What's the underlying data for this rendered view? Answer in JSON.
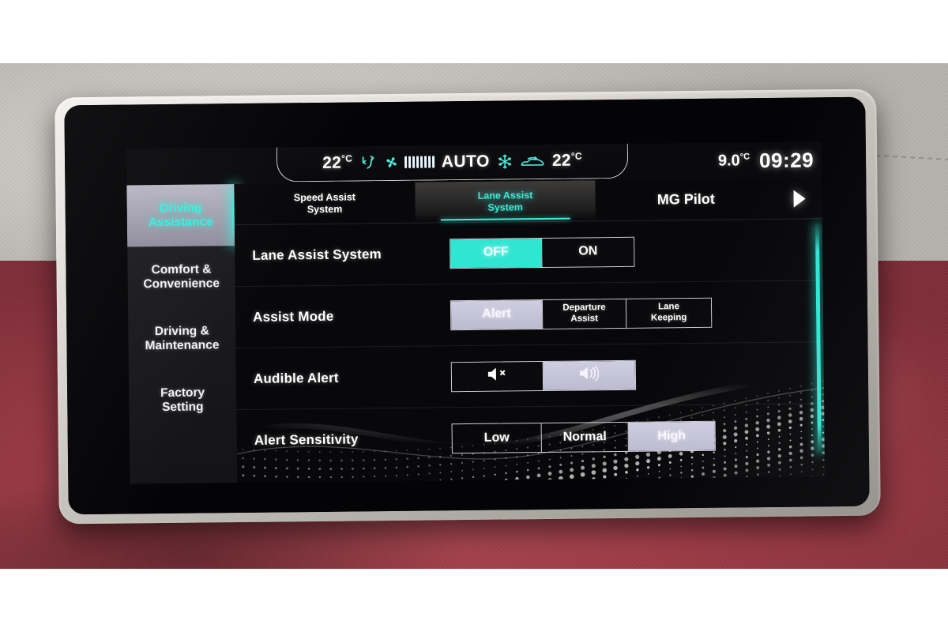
{
  "status_bar": {
    "cabin_temp_left": "22",
    "cabin_temp_left_unit": "°C",
    "airflow_icon": "airflow-direction-icon",
    "fan_icon": "fan-icon",
    "fan_level_bars": 8,
    "auto_label": "AUTO",
    "ac_icon": "snowflake-icon",
    "recirculation_icon": "air-recirculation-car-icon",
    "cabin_temp_right": "22",
    "cabin_temp_right_unit": "°C",
    "outside_temp": "9.0",
    "outside_temp_unit": "°C",
    "clock": "09:29"
  },
  "sidebar": {
    "items": [
      {
        "label_line1": "Driving",
        "label_line2": "Assistance",
        "active": true
      },
      {
        "label_line1": "Comfort &",
        "label_line2": "Convenience",
        "active": false
      },
      {
        "label_line1": "Driving &",
        "label_line2": "Maintenance",
        "active": false
      },
      {
        "label_line1": "Factory",
        "label_line2": "Setting",
        "active": false
      }
    ]
  },
  "tabs": {
    "items": [
      {
        "line1": "Speed Assist",
        "line2": "System",
        "active": false
      },
      {
        "line1": "Lane Assist",
        "line2": "System",
        "active": true
      },
      {
        "line1": "MG Pilot",
        "line2": "",
        "active": false
      }
    ],
    "next_arrow_icon": "next-arrow-icon"
  },
  "settings": {
    "rows": [
      {
        "label": "Lane Assist System",
        "options": [
          {
            "text": "OFF",
            "selected": true,
            "style": "cyan"
          },
          {
            "text": "ON",
            "selected": false,
            "style": "dark"
          }
        ]
      },
      {
        "label": "Assist Mode",
        "options": [
          {
            "text": "Alert",
            "selected": true,
            "style": "lavender"
          },
          {
            "line1": "Departure",
            "line2": "Assist",
            "selected": false,
            "style": "dark"
          },
          {
            "line1": "Lane",
            "line2": "Keeping",
            "selected": false,
            "style": "dark"
          }
        ]
      },
      {
        "label": "Audible Alert",
        "options": [
          {
            "icon": "speaker-mute-icon",
            "selected": false,
            "style": "dark"
          },
          {
            "icon": "speaker-on-icon",
            "selected": true,
            "style": "lavender"
          }
        ]
      },
      {
        "label": "Alert Sensitivity",
        "options": [
          {
            "text": "Low",
            "selected": false,
            "style": "dark"
          },
          {
            "text": "Normal",
            "selected": false,
            "style": "dark"
          },
          {
            "text": "High",
            "selected": true,
            "style": "lavender"
          }
        ]
      }
    ]
  },
  "colors": {
    "accent_cyan": "#2fe6d2",
    "selected_lavender": "#c7c5da",
    "screen_background": "#08080a",
    "text_primary": "#ffffff"
  },
  "scrollbar": {
    "name": "vertical-scrollbar",
    "color": "#2fe6d2"
  }
}
